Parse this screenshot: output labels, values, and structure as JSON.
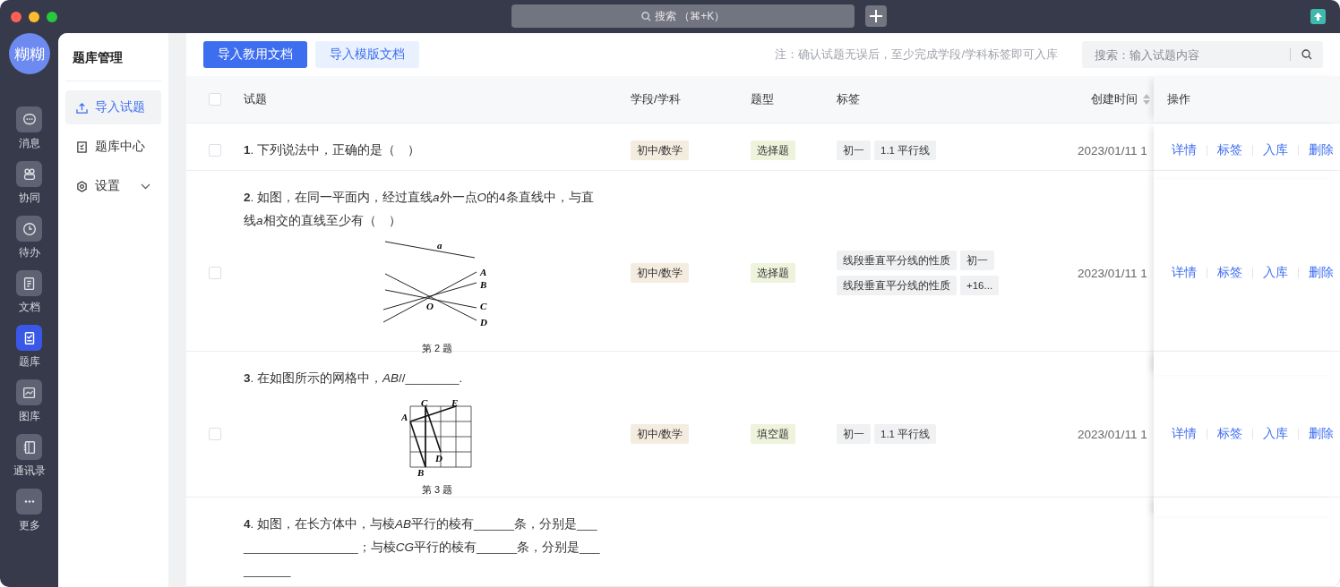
{
  "window": {
    "search": "搜索 （⌘+K）"
  },
  "nav_rail": {
    "avatar": "糊糊",
    "items": [
      {
        "label": "消息",
        "selected": false
      },
      {
        "label": "协同",
        "selected": false
      },
      {
        "label": "待办",
        "selected": false
      },
      {
        "label": "文档",
        "selected": false
      },
      {
        "label": "题库",
        "selected": true
      },
      {
        "label": "图库",
        "selected": false
      },
      {
        "label": "通讯录",
        "selected": false
      },
      {
        "label": "更多",
        "selected": false
      }
    ]
  },
  "sidebar": {
    "title": "题库管理",
    "items": [
      {
        "label": "导入试题",
        "kind": "link",
        "selected": true
      },
      {
        "label": "题库中心",
        "kind": "link",
        "selected": false
      },
      {
        "label": "设置",
        "kind": "group",
        "selected": false,
        "expanded": false
      }
    ]
  },
  "toolbar": {
    "buttons": [
      {
        "label": "导入教用文档",
        "primary": true
      },
      {
        "label": "导入模版文档",
        "primary": false
      }
    ],
    "note": "注：确认试题无误后，至少完成学段/学科标签即可入库",
    "search": {
      "placeholder": "搜索：输入试题内容"
    }
  },
  "table": {
    "select_all_checked": false,
    "columns": [
      "试题",
      "学段/学科",
      "题型",
      "标签",
      "创建时间",
      "操作"
    ],
    "rows": [
      {
        "checked": false,
        "question": [
          {
            "text": "1",
            "bold": true
          },
          {
            "text": ". 下列说法中，正确的是（　）"
          }
        ],
        "subject": "初中/数学",
        "type": "选择题",
        "tags": [
          "初一",
          "1.1 平行线"
        ],
        "created": "2023/01/11 1",
        "actions": [
          "详情",
          "标签",
          "入库",
          "删除"
        ]
      },
      {
        "checked": false,
        "question": [
          {
            "text": "2",
            "bold": true
          },
          {
            "text": ". 如图，在同一平面内，经过直线"
          },
          {
            "text": "a",
            "italic": true
          },
          {
            "text": "外一点"
          },
          {
            "text": "O",
            "italic": true
          },
          {
            "text": "的4条直线中，与直线"
          },
          {
            "text": "a",
            "italic": true
          },
          {
            "text": "相交的直线至少有（　）"
          }
        ],
        "figure": {
          "kind": "lines",
          "labels": [
            "a",
            "A",
            "B",
            "C",
            "D",
            "O"
          ],
          "caption": "第 2 题"
        },
        "subject": "初中/数学",
        "type": "选择题",
        "tags": [
          "线段垂直平分线的性质",
          "初一",
          "线段垂直平分线的性质",
          "+16..."
        ],
        "created": "2023/01/11 1",
        "actions": [
          "详情",
          "标签",
          "入库",
          "删除"
        ]
      },
      {
        "checked": false,
        "question": [
          {
            "text": "3",
            "bold": true
          },
          {
            "text": ". 在如图所示的网格中，"
          },
          {
            "text": "AB",
            "italic": true
          },
          {
            "text": "//________."
          }
        ],
        "figure": {
          "kind": "grid",
          "labels": [
            "C",
            "E",
            "A",
            "D",
            "B"
          ],
          "caption": "第 3 题"
        },
        "subject": "初中/数学",
        "type": "填空题",
        "tags": [
          "初一",
          "1.1 平行线"
        ],
        "created": "2023/01/11 1",
        "actions": [
          "详情",
          "标签",
          "入库",
          "删除"
        ]
      },
      {
        "question": [
          {
            "text": "4",
            "bold": true
          },
          {
            "text": ". 如图，在长方体中，与棱"
          },
          {
            "text": "AB",
            "italic": true
          },
          {
            "text": "平行的棱有______条，分别是____________________；与棱"
          },
          {
            "text": "CG",
            "italic": true
          },
          {
            "text": "平行的棱有______条，分别是__________"
          }
        ]
      }
    ]
  }
}
